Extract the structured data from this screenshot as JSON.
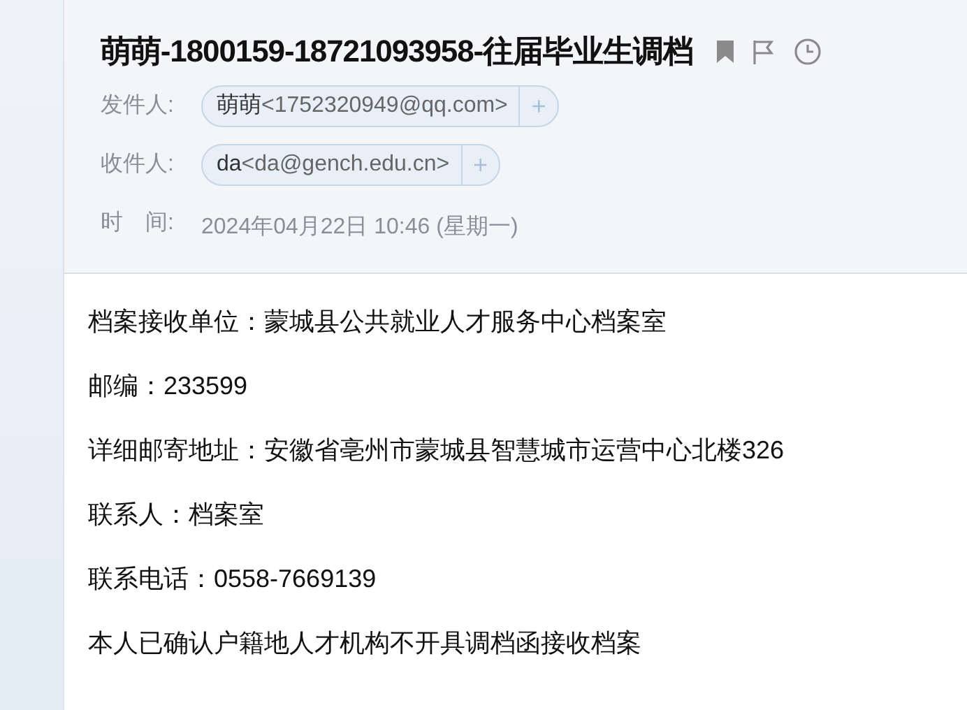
{
  "email": {
    "subject": "萌萌-1800159-18721093958-往届毕业生调档",
    "fields": [
      {
        "kind": "contact",
        "label": "发件人:",
        "name": "萌萌",
        "address": "<1752320949@qq.com>",
        "add": "+"
      },
      {
        "kind": "contact",
        "label": "收件人:",
        "name": "da",
        "address": "<da@gench.edu.cn>",
        "add": "+"
      },
      {
        "kind": "text",
        "label": "时　间:",
        "value": "2024年04月22日 10:46 (星期一)"
      }
    ],
    "body": [
      "档案接收单位：蒙城县公共就业人才服务中心档案室",
      "邮编：233599",
      "详细邮寄地址：安徽省亳州市蒙城县智慧城市运营中心北楼326",
      "联系人：档案室",
      "联系电话：0558-7669139",
      "本人已确认户籍地人才机构不开具调档函接收档案"
    ]
  }
}
